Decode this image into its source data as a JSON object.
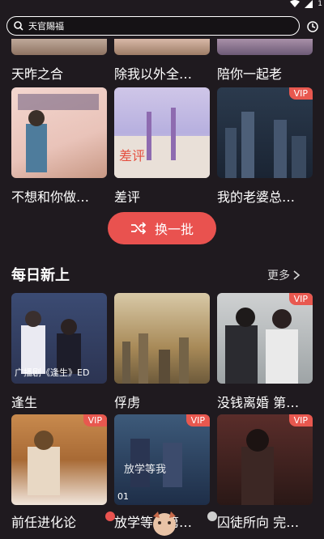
{
  "status_bar": {
    "battery_text": "1"
  },
  "search": {
    "query": "天官賜福"
  },
  "row_top": {
    "titles": [
      "天昨之合",
      "除我以外全…",
      "陪你一起老"
    ]
  },
  "row_two": {
    "cards": [
      {
        "title": "不想和你做…",
        "vip": ""
      },
      {
        "title": "差评",
        "vip": ""
      },
      {
        "title": "我的老婆总…",
        "vip": "VIP"
      }
    ]
  },
  "shuffle": {
    "label": "换一批"
  },
  "daily": {
    "section_title": "每日新上",
    "more_label": "更多",
    "cards": [
      {
        "title": "逢生",
        "caption": "广播剧《逢生》ED",
        "vip": ""
      },
      {
        "title": "俘虏",
        "caption": "",
        "vip": ""
      },
      {
        "title": "没钱离婚 第…",
        "caption": "",
        "vip": "VIP"
      }
    ],
    "cards_row2": [
      {
        "title": "前任进化论",
        "index": "",
        "vip": "VIP"
      },
      {
        "title": "放学等…第…",
        "index": "01",
        "vip": "VIP"
      },
      {
        "title": "囚徒所向 完…",
        "index": "",
        "vip": "VIP"
      }
    ]
  },
  "colors": {
    "accent": "#e9524f",
    "background": "#1f1a1f"
  }
}
